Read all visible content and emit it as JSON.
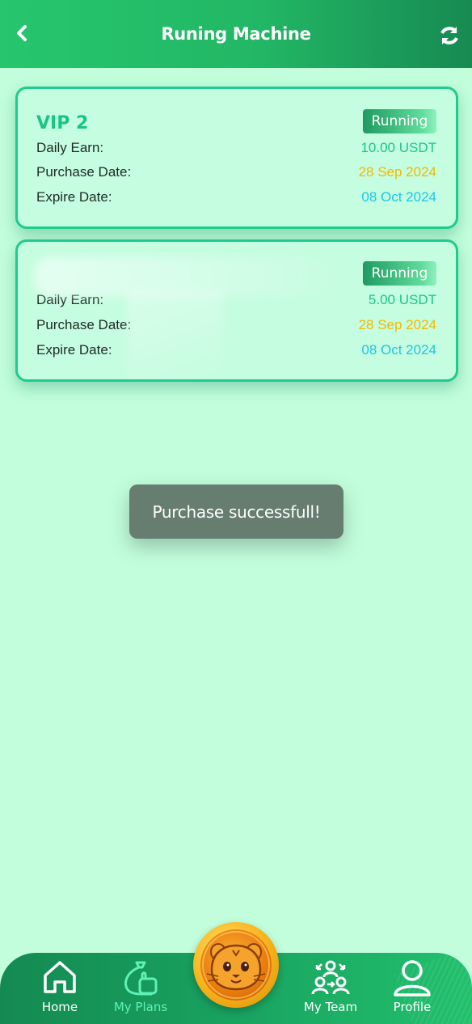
{
  "header": {
    "title": "Runing Machine"
  },
  "cards": [
    {
      "plan_name": "VIP 2",
      "status": "Running",
      "daily_earn_label": "Daily Earn:",
      "daily_earn_value": "10.00 USDT",
      "purchase_date_label": "Purchase Date:",
      "purchase_date_value": "28 Sep 2024",
      "expire_date_label": "Expire Date:",
      "expire_date_value": "08 Oct 2024"
    },
    {
      "plan_name": "",
      "status": "Running",
      "daily_earn_label": "Daily Earn:",
      "daily_earn_value": "5.00 USDT",
      "purchase_date_label": "Purchase Date:",
      "purchase_date_value": "28 Sep 2024",
      "expire_date_label": "Expire Date:",
      "expire_date_value": "08 Oct 2024"
    }
  ],
  "toast": {
    "message": "Purchase successfull!"
  },
  "tabbar": {
    "items": [
      {
        "label": "Home",
        "icon": "home-icon"
      },
      {
        "label": "My Plans",
        "icon": "money-bag-icon",
        "active": true
      },
      {
        "label": "",
        "icon": "hamster-coin-icon"
      },
      {
        "label": "My Team",
        "icon": "team-icon"
      },
      {
        "label": "Profile",
        "icon": "user-icon"
      }
    ]
  },
  "colors": {
    "background": "#c2fedc",
    "accent": "#17c584",
    "earn_value": "#19c78a",
    "purchase_date": "#f5b800",
    "expire_date": "#1ec6e4",
    "active_tab": "#5ff2b5"
  }
}
